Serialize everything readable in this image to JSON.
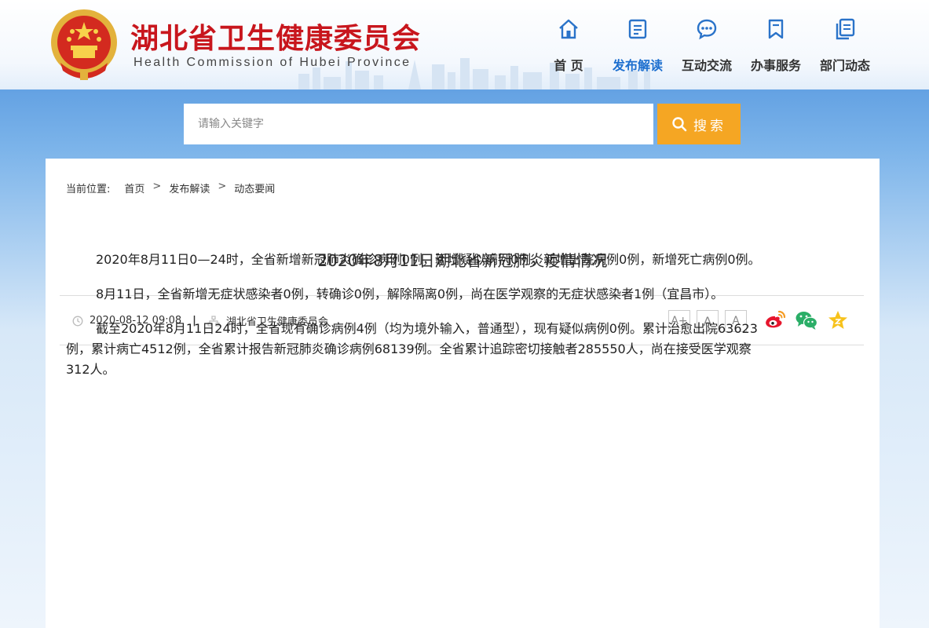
{
  "header": {
    "site_title": "湖北省卫生健康委员会",
    "site_subtitle": "Health Commission of Hubei Province"
  },
  "nav": {
    "items": [
      {
        "label": "首 页",
        "icon": "home-icon"
      },
      {
        "label": "发布解读",
        "icon": "document-icon",
        "active": true
      },
      {
        "label": "互动交流",
        "icon": "chat-icon"
      },
      {
        "label": "办事服务",
        "icon": "bookmark-icon"
      },
      {
        "label": "部门动态",
        "icon": "copy-icon"
      }
    ]
  },
  "search": {
    "placeholder": "请输入关键字",
    "button_label": "搜索"
  },
  "breadcrumb": {
    "prefix": "当前位置:",
    "items": [
      "首页",
      "发布解读",
      "动态要闻"
    ]
  },
  "article": {
    "title": "2020年8月11日湖北省新冠肺炎疫情情况",
    "date": "2020-08-12 09:08",
    "source": "湖北省卫生健康委员会",
    "paragraphs": [
      "2020年8月11日0—24时，全省新增新冠肺炎确诊病例0例，新增疑似病例0例，新增出院病例0例，新增死亡病例0例。",
      "8月11日，全省新增无症状感染者0例，转确诊0例，解除隔离0例，尚在医学观察的无症状感染者1例（宜昌市）。",
      "截至2020年8月11日24时，全省现有确诊病例4例（均为境外输入，普通型），现有疑似病例0例。累计治愈出院63623例，累计病亡4512例，全省累计报告新冠肺炎确诊病例68139例。全省累计追踪密切接触者285550人，尚在接受医学观察312人。"
    ]
  },
  "toolbar": {
    "font_large": "A+",
    "font_medium": "A",
    "font_small": "A",
    "share_icons": [
      "weibo-icon",
      "wechat-icon",
      "favorite-icon"
    ]
  },
  "colors": {
    "brand_red": "#c8161d",
    "nav_active": "#1d6fcf",
    "search_button": "#f5a623"
  }
}
